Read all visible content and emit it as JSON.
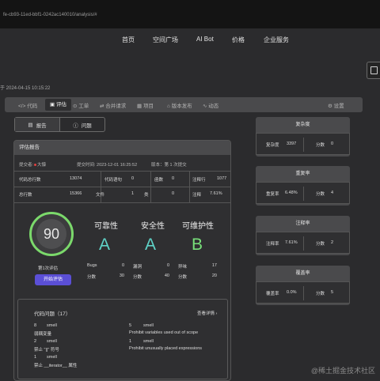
{
  "url": "fe-cb93-11ed-bbf1-0242ac140010/analysis/#",
  "nav": [
    "首页",
    "空间广场",
    "AI Bot",
    "价格",
    "企业服务"
  ],
  "date": "于 2024-04-15 10:15:22",
  "tabs": [
    {
      "label": "代码",
      "icon": "code-icon"
    },
    {
      "label": "评估",
      "icon": "clipboard-icon"
    },
    {
      "label": "工单",
      "icon": "ticket-icon"
    },
    {
      "label": "合并请求",
      "icon": "merge-icon"
    },
    {
      "label": "项目",
      "icon": "project-icon"
    },
    {
      "label": "版本发布",
      "icon": "release-icon"
    },
    {
      "label": "动态",
      "icon": "activity-icon"
    },
    {
      "label": "设置",
      "icon": "gear-icon"
    }
  ],
  "segments": {
    "report": "报告",
    "issues": "问题"
  },
  "report": {
    "title": "评估报告",
    "submitter_label": "提交者:",
    "submitter": "大慷",
    "submit_time": "提交时间: 2023-12-01 16:25:52",
    "version": "版本：第 1 次提交",
    "stats": [
      {
        "label": "代码总行数",
        "value": "13074"
      },
      {
        "label": "代码语句",
        "value": "0"
      },
      {
        "label": "函数",
        "value": "0"
      },
      {
        "label": "注释行",
        "value": "1077"
      },
      {
        "label": "总行数",
        "value": "15366"
      },
      {
        "label": "文件",
        "value": "1"
      },
      {
        "label": "类",
        "value": "0"
      },
      {
        "label": "注释",
        "value": "7.61%"
      }
    ],
    "score": "90",
    "eval_count": "第1次评估",
    "start_button": "开始评估",
    "metrics": [
      {
        "name": "可靠性",
        "grade": "A",
        "color": "#5fd3c8",
        "rows": [
          {
            "label": "Bugs",
            "value": "0"
          },
          {
            "label": "分数",
            "value": "30"
          }
        ]
      },
      {
        "name": "安全性",
        "grade": "A",
        "color": "#5fd3c8",
        "rows": [
          {
            "label": "漏洞",
            "value": "0"
          },
          {
            "label": "分数",
            "value": "40"
          }
        ]
      },
      {
        "name": "可维护性",
        "grade": "B",
        "color": "#78e07a",
        "rows": [
          {
            "label": "异味",
            "value": "17"
          },
          {
            "label": "分数",
            "value": "20"
          }
        ]
      }
    ],
    "issues": {
      "title": "代码问题（17）",
      "detail_link": "查看详情",
      "items": [
        {
          "count": "8",
          "type": "smell",
          "desc": "弱耦变量"
        },
        {
          "count": "5",
          "type": "smell",
          "desc": "Prohibit variables used out of scope"
        },
        {
          "count": "2",
          "type": "smell",
          "desc": "禁止 \"||\" 符号"
        },
        {
          "count": "1",
          "type": "smell",
          "desc": "Prohibit unusually placed expressions"
        },
        {
          "count": "1",
          "type": "smell",
          "desc": "禁止 __iterator__ 属性"
        }
      ]
    }
  },
  "side_cards": [
    {
      "title": "复杂度",
      "left_label": "复杂度",
      "left_value": "3397",
      "right_label": "分数",
      "right_value": "0"
    },
    {
      "title": "重复率",
      "left_label": "重复率",
      "left_value": "6.48%",
      "right_label": "分数",
      "right_value": "4"
    },
    {
      "title": "注释率",
      "left_label": "注释率",
      "left_value": "7.61%",
      "right_label": "分数",
      "right_value": "2"
    },
    {
      "title": "覆盖率",
      "left_label": "覆盖率",
      "left_value": "0.0%",
      "right_label": "分数",
      "right_value": "5"
    }
  ],
  "watermark": "@稀土掘金技术社区",
  "colors": {
    "accent": "#5b4fd6",
    "ring": "#7bd96b",
    "grade_a": "#5fd3c8",
    "grade_b": "#78e07a",
    "submitter_dot": "#e04040"
  }
}
